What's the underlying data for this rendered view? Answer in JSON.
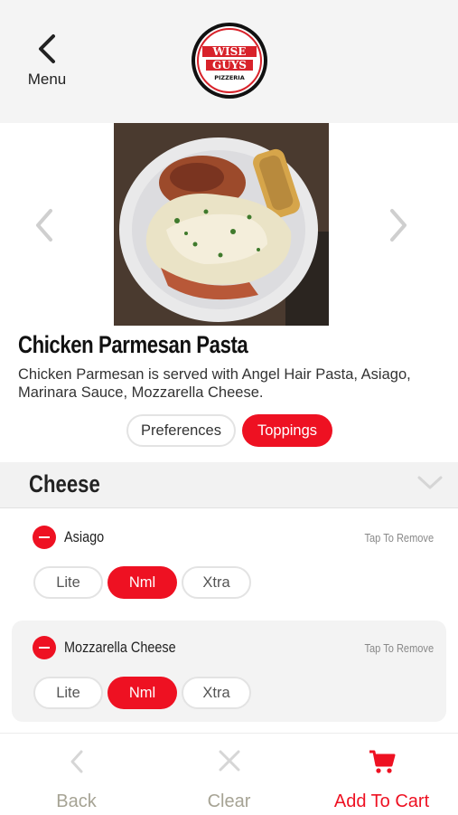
{
  "header": {
    "back_label": "Menu",
    "logo_text": [
      "WISE",
      "GUYS",
      "PIZZERIA"
    ]
  },
  "item": {
    "title": "Chicken Parmesan Pasta",
    "description": "Chicken Parmesan is served with Angel Hair Pasta, Asiago, Marinara Sauce, Mozzarella Cheese."
  },
  "tabs": [
    {
      "label": "Preferences",
      "active": false
    },
    {
      "label": "Toppings",
      "active": true
    }
  ],
  "section": {
    "title": "Cheese"
  },
  "toppings": [
    {
      "name": "Asiago",
      "action": "Tap To Remove",
      "amounts": [
        "Lite",
        "Nml",
        "Xtra"
      ],
      "selected": "Nml"
    },
    {
      "name": "Mozzarella Cheese",
      "action": "Tap To Remove",
      "amounts": [
        "Lite",
        "Nml",
        "Xtra"
      ],
      "selected": "Nml"
    }
  ],
  "footer": {
    "back": "Back",
    "clear": "Clear",
    "add_to_cart": "Add To Cart"
  },
  "colors": {
    "accent": "#ee1122",
    "footer_inactive": "#a6a394",
    "header_bg": "#f4f4f4"
  }
}
